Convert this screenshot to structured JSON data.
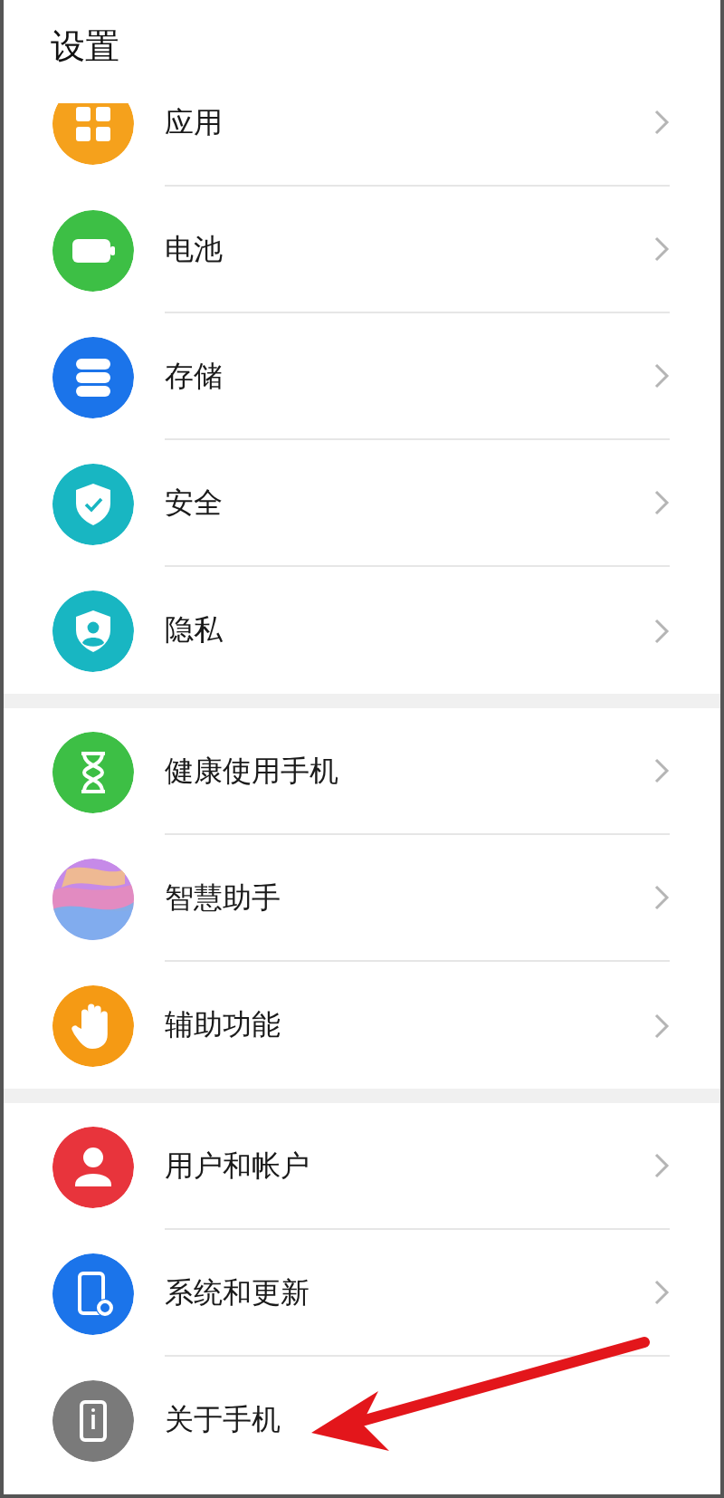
{
  "title": "设置",
  "groups": [
    {
      "items": [
        {
          "label": "应用",
          "kind": "apps",
          "color": "#f5a11c",
          "chevron": true
        },
        {
          "label": "电池",
          "kind": "battery",
          "color": "#3dbf45",
          "chevron": true
        },
        {
          "label": "存储",
          "kind": "storage",
          "color": "#1b74ea",
          "chevron": true
        },
        {
          "label": "安全",
          "kind": "shield",
          "color": "#18b6c2",
          "chevron": true
        },
        {
          "label": "隐私",
          "kind": "privacy",
          "color": "#18b6c2",
          "chevron": true
        }
      ]
    },
    {
      "items": [
        {
          "label": "健康使用手机",
          "kind": "hourglass",
          "color": "#3dbf45",
          "chevron": true
        },
        {
          "label": "智慧助手",
          "kind": "assistant",
          "color": "#c68ae8",
          "chevron": true
        },
        {
          "label": "辅助功能",
          "kind": "hand",
          "color": "#f59a14",
          "chevron": true
        }
      ]
    },
    {
      "items": [
        {
          "label": "用户和帐户",
          "kind": "user",
          "color": "#e8343c",
          "chevron": true
        },
        {
          "label": "系统和更新",
          "kind": "phone-gear",
          "color": "#1b74ea",
          "chevron": true
        },
        {
          "label": "关于手机",
          "kind": "phone-info",
          "color": "#7a7a7a",
          "chevron": false
        }
      ]
    }
  ]
}
